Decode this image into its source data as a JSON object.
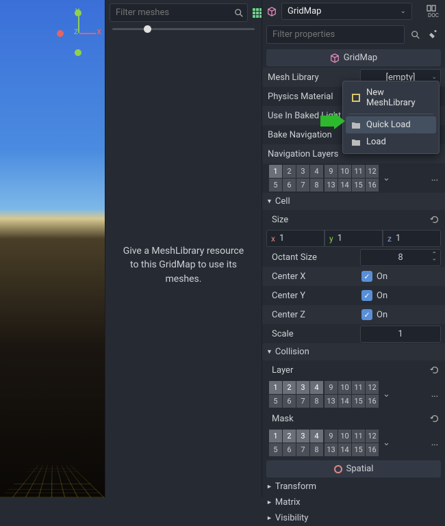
{
  "viewport": {
    "axes": {
      "x": "X",
      "y": "Y",
      "z": "Z"
    }
  },
  "middle": {
    "filter_placeholder": "Filter meshes",
    "placeholder_text": "Give a MeshLibrary resource to this GridMap to use its meshes."
  },
  "inspector": {
    "node_name": "GridMap",
    "filter_placeholder": "Filter properties",
    "doc_label": "DOC",
    "section_title": "GridMap",
    "props": {
      "mesh_library_label": "Mesh Library",
      "mesh_library_value": "[empty]",
      "physics_material_label": "Physics Material",
      "use_in_baked_light_label": "Use In Baked Light",
      "bake_navigation_label": "Bake Navigation",
      "navigation_layers_label": "Navigation Layers"
    },
    "nav_layers": {
      "block1": [
        "1",
        "2",
        "3",
        "4",
        "5",
        "6",
        "7",
        "8"
      ],
      "block2": [
        "9",
        "10",
        "11",
        "12",
        "13",
        "14",
        "15",
        "16"
      ],
      "active_block1": [
        0
      ],
      "ellipsis": "..."
    },
    "cell": {
      "title": "Cell",
      "size_label": "Size",
      "size": {
        "x": "1",
        "y": "1",
        "z": "1"
      },
      "octant_label": "Octant Size",
      "octant_value": "8",
      "center_x_label": "Center X",
      "center_y_label": "Center Y",
      "center_z_label": "Center Z",
      "on_label": "On",
      "scale_label": "Scale",
      "scale_value": "1"
    },
    "collision": {
      "title": "Collision",
      "layer_label": "Layer",
      "mask_label": "Mask",
      "layer_block1": [
        "1",
        "2",
        "3",
        "4",
        "5",
        "6",
        "7",
        "8"
      ],
      "layer_block2": [
        "9",
        "10",
        "11",
        "12",
        "13",
        "14",
        "15",
        "16"
      ],
      "layer_active": [
        0,
        1,
        2,
        3
      ],
      "mask_active": [
        0,
        1,
        2,
        3
      ],
      "ellipsis": "..."
    },
    "spatial": {
      "title": "Spatial",
      "transform": "Transform",
      "matrix": "Matrix",
      "visibility": "Visibility"
    },
    "context_menu": {
      "new_meshlib": "New MeshLibrary",
      "quick_load": "Quick Load",
      "load": "Load"
    },
    "axis_labels": {
      "x": "x",
      "y": "y",
      "z": "z"
    }
  }
}
